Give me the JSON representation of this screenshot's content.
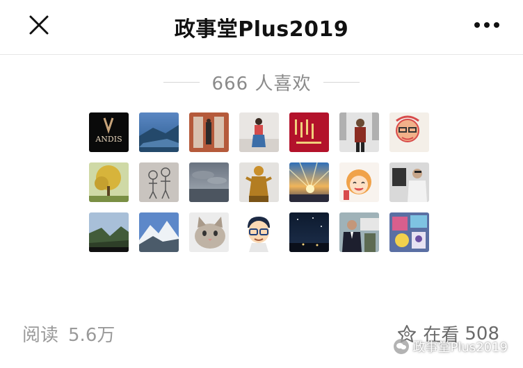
{
  "header": {
    "title": "政事堂Plus2019",
    "close_icon": "close-icon",
    "more_icon": "more-dots-icon"
  },
  "likes": {
    "count": "666",
    "suffix": "人喜欢"
  },
  "avatars": [
    {
      "name": "avatar-andis",
      "text": "ANDIS"
    },
    {
      "name": "avatar-mountain-lake"
    },
    {
      "name": "avatar-brick-building"
    },
    {
      "name": "avatar-woman-street"
    },
    {
      "name": "avatar-red-poster"
    },
    {
      "name": "avatar-man-street"
    },
    {
      "name": "avatar-cartoon-face"
    },
    {
      "name": "avatar-yellow-tree"
    },
    {
      "name": "avatar-sketch-figures"
    },
    {
      "name": "avatar-cloudy-sky"
    },
    {
      "name": "avatar-golden-statue"
    },
    {
      "name": "avatar-sunset-rays"
    },
    {
      "name": "avatar-cartoon-girl"
    },
    {
      "name": "avatar-man-reading"
    },
    {
      "name": "avatar-valley"
    },
    {
      "name": "avatar-snow-mountain"
    },
    {
      "name": "avatar-cat"
    },
    {
      "name": "avatar-cartoon-man-glasses"
    },
    {
      "name": "avatar-night-sky"
    },
    {
      "name": "avatar-man-suit"
    },
    {
      "name": "avatar-colorful-collage"
    }
  ],
  "footer": {
    "read_label": "阅读",
    "read_count": "5.6万",
    "view_label": "在看",
    "view_count": "508"
  },
  "watermark": {
    "text": "政事堂Plus2019"
  },
  "colors": {
    "divider": "#e6e6e6",
    "muted_text": "#9a9a9a"
  }
}
